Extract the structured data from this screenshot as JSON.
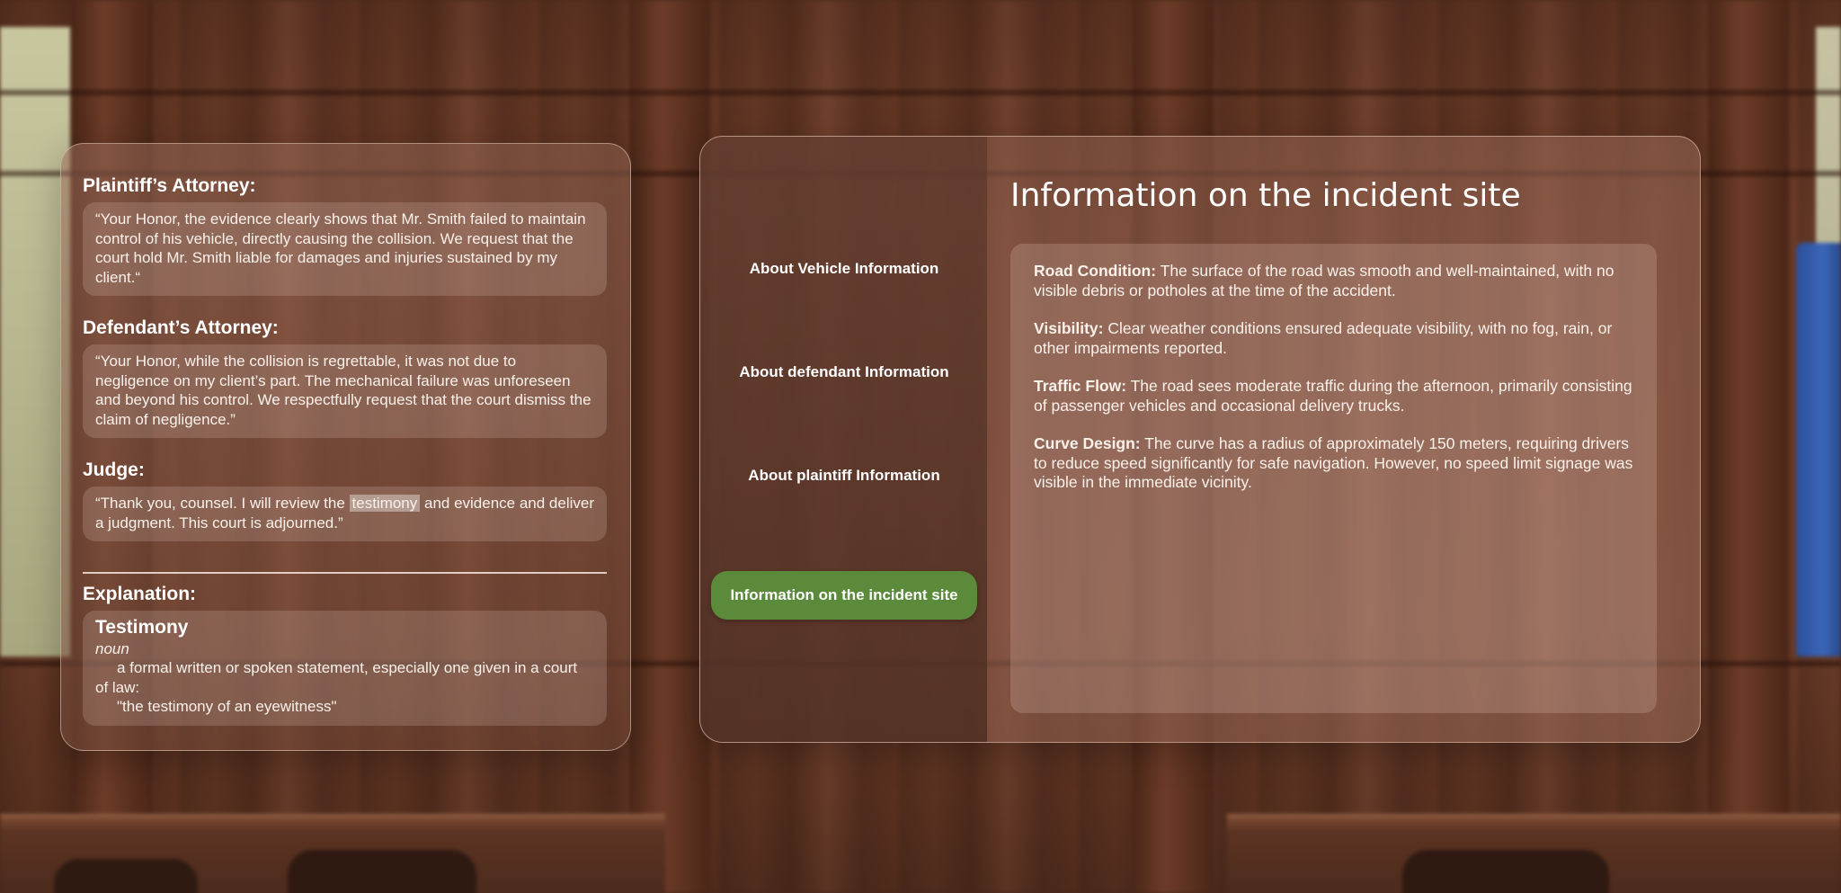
{
  "transcript": {
    "plaintiff": {
      "heading": "Plaintiff’s Attorney:",
      "quote": "“Your Honor, the evidence clearly shows that Mr. Smith failed to maintain control of his vehicle, directly causing the collision. We request that the court hold Mr. Smith liable for damages and injuries sustained by my client.“"
    },
    "defendant": {
      "heading": "Defendant’s Attorney:",
      "quote": "“Your Honor, while the collision is regrettable, it was not due to negligence on my client’s part. The mechanical failure was unforeseen and beyond his control. We respectfully request that the court dismiss the claim of negligence.”"
    },
    "judge": {
      "heading": "Judge:",
      "quote_before": "“Thank you, counsel. I will review the ",
      "quote_highlight": "testimony",
      "quote_after": " and evidence and deliver a judgment. This court is adjourned.”"
    },
    "explanation": {
      "heading": "Explanation:",
      "term": "Testimony",
      "pos": "noun",
      "definition": "a formal written or spoken statement, especially one given in a court of law:",
      "example": "\"the testimony of an eyewitness\""
    }
  },
  "nav": {
    "items": [
      {
        "label": "About Vehicle Information",
        "active": false
      },
      {
        "label": "About defendant Information",
        "active": false
      },
      {
        "label": "About plaintiff Information",
        "active": false
      },
      {
        "label": "Information on the incident site",
        "active": true
      }
    ],
    "active_color": "#5a8a3a"
  },
  "content": {
    "title": "Information on the incident site",
    "paragraphs": [
      {
        "label": "Road Condition:",
        "text": " The surface of the road was smooth and well-maintained, with no visible debris or potholes at the time of the accident."
      },
      {
        "label": "Visibility:",
        "text": " Clear weather conditions ensured adequate visibility, with no fog, rain, or other impairments reported."
      },
      {
        "label": "Traffic Flow:",
        "text": " The road sees moderate traffic during the afternoon, primarily consisting of passenger vehicles and occasional delivery trucks."
      },
      {
        "label": "Curve Design:",
        "text": " The curve has a radius of approximately 150 meters, requiring drivers to reduce speed significantly for safe navigation. However, no speed limit signage was visible in the immediate vicinity."
      }
    ]
  }
}
